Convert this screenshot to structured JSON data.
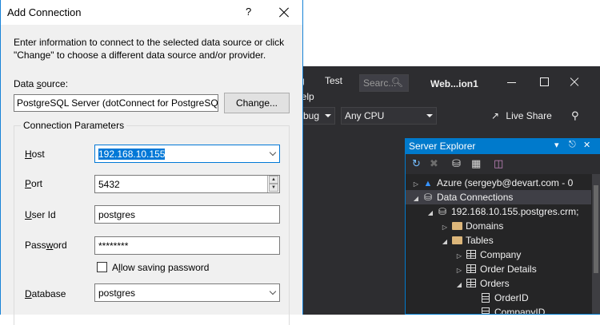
{
  "dialog": {
    "title": "Add Connection",
    "help_glyph": "?",
    "intro_text": "Enter information to connect to the selected data source or click \"Change\" to choose a different data source and/or provider.",
    "data_source_label_a": "Data ",
    "data_source_label_u": "s",
    "data_source_label_b": "ource:",
    "data_source_value": "PostgreSQL Server (dotConnect for PostgreSQL)",
    "change_button": "Change...",
    "group_title": "Connection Parameters",
    "host_label_u": "H",
    "host_label_rest": "ost",
    "host_value": "192.168.10.155",
    "port_label_u": "P",
    "port_label_rest": "ort",
    "port_value": "5432",
    "user_label_u": "U",
    "user_label_rest": "ser Id",
    "user_value": "postgres",
    "password_label_a": "Pass",
    "password_label_u": "w",
    "password_label_b": "ord",
    "password_value": "********",
    "allow_saving_label_a": "A",
    "allow_saving_label_u": "l",
    "allow_saving_label_b": "low saving password",
    "allow_saving_checked": false,
    "database_label_u": "D",
    "database_label_rest": "atabase",
    "database_value": "postgres"
  },
  "vs": {
    "menu_partial": "g",
    "menu_test": "Test",
    "menu_help_partial": "lelp",
    "search_placeholder": "Searc...",
    "window_title": "Web...ion1",
    "config_partial": "bug",
    "platform": "Any CPU",
    "live_share": "Live Share",
    "server_explorer_title": "Server Explorer",
    "tree": [
      {
        "label": "Azure (sergeyb@devart.com - 0",
        "expander": "▷",
        "icon": "azure"
      },
      {
        "label": "Data Connections",
        "expander": "◢",
        "icon": "db",
        "selected": true
      },
      {
        "label": "192.168.10.155.postgres.crm;",
        "expander": "◢",
        "icon": "db"
      },
      {
        "label": "Domains",
        "expander": "▷",
        "icon": "folder"
      },
      {
        "label": "Tables",
        "expander": "◢",
        "icon": "folder"
      },
      {
        "label": "Company",
        "expander": "▷",
        "icon": "table"
      },
      {
        "label": "Order Details",
        "expander": "▷",
        "icon": "table"
      },
      {
        "label": "Orders",
        "expander": "◢",
        "icon": "table"
      },
      {
        "label": "OrderID",
        "expander": "",
        "icon": "column"
      },
      {
        "label": "CompanyID",
        "expander": "",
        "icon": "column"
      }
    ]
  }
}
